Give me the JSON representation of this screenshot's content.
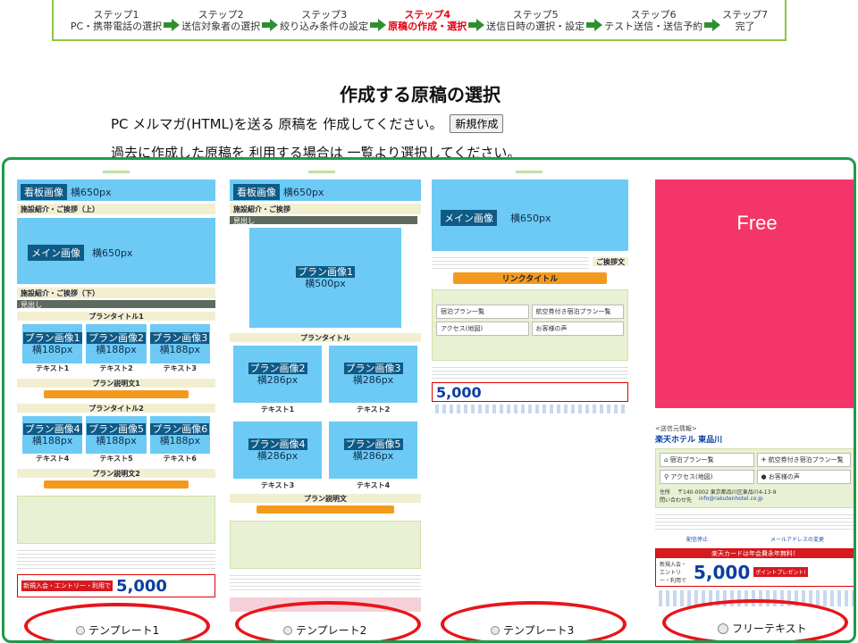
{
  "steps": [
    {
      "num": "ステップ1",
      "label": "PC・携帯電話の選択",
      "active": false
    },
    {
      "num": "ステップ2",
      "label": "送信対象者の選択",
      "active": false
    },
    {
      "num": "ステップ3",
      "label": "絞り込み条件の設定",
      "active": false
    },
    {
      "num": "ステップ4",
      "label": "原稿の作成・選択",
      "active": true
    },
    {
      "num": "ステップ5",
      "label": "送信日時の選択・設定",
      "active": false
    },
    {
      "num": "ステップ6",
      "label": "テスト送信・送信予約",
      "active": false
    },
    {
      "num": "ステップ7",
      "label": "完了",
      "active": false
    }
  ],
  "page": {
    "heading": "作成する原稿の選択",
    "line1_text": "PC メルマガ(HTML)を送る 原稿を 作成してください。",
    "new_button": "新規作成",
    "line2_text": "過去に作成した原稿を 利用する場合は 一覧より選択してください。"
  },
  "templates": {
    "t1": {
      "kanban": "看板画像",
      "kanban_size": "横650px",
      "intro_top": "施設紹介・ご挨拶（上）",
      "main": "メイン画像",
      "main_size": "横650px",
      "intro_bottom": "施設紹介・ご挨拶（下）",
      "midashi": "見出し",
      "plan_title_1": "プランタイトル1",
      "plan_images": [
        {
          "name": "プラン画像1",
          "size": "横188px",
          "text": "テキスト1"
        },
        {
          "name": "プラン画像2",
          "size": "横188px",
          "text": "テキスト2"
        },
        {
          "name": "プラン画像3",
          "size": "横188px",
          "text": "テキスト3"
        }
      ],
      "plan_desc_1": "プラン説明文1",
      "plan_title_2": "プランタイトル2",
      "plan_images_2": [
        {
          "name": "プラン画像4",
          "size": "横188px",
          "text": "テキスト4"
        },
        {
          "name": "プラン画像5",
          "size": "横188px",
          "text": "テキスト5"
        },
        {
          "name": "プラン画像6",
          "size": "横188px",
          "text": "テキスト6"
        }
      ],
      "plan_desc_2": "プラン説明文2",
      "radio_label": "テンプレート1"
    },
    "t2": {
      "kanban": "看板画像",
      "kanban_size": "横650px",
      "intro": "施設紹介・ご挨拶",
      "midashi": "見出し",
      "plan_image": "プラン画像1",
      "plan_image_size": "横500px",
      "plan_title": "プランタイトル",
      "plan_images": [
        {
          "name": "プラン画像2",
          "size": "横286px",
          "text": "テキスト1"
        },
        {
          "name": "プラン画像3",
          "size": "横286px",
          "text": "テキスト2"
        },
        {
          "name": "プラン画像4",
          "size": "横286px",
          "text": "テキスト3"
        },
        {
          "name": "プラン画像5",
          "size": "横286px",
          "text": "テキスト4"
        }
      ],
      "plan_desc": "プラン説明文",
      "radio_label": "テンプレート2"
    },
    "t3": {
      "main": "メイン画像",
      "main_size": "横650px",
      "greeting": "ご挨拶文",
      "link_title": "リンクタイトル",
      "radio_label": "テンプレート3"
    },
    "free": {
      "box_label": "Free",
      "hotel": "楽天ホテル 東品川",
      "info_label": "<送信元情報>",
      "btn_plans": "宿泊プラン一覧",
      "btn_air": "航空券付き宿泊プラン一覧",
      "btn_access": "アクセス(地図)",
      "btn_voice": "お客様の声",
      "address_label": "住所",
      "address": "〒140-0002 東京都品川区東品川4-13-9",
      "contact_label": "問い合わせ先",
      "contact": "info@rakutenhotel.co.jp",
      "link_stop": "配信停止",
      "link_change": "メールアドレスの変更",
      "banner_red": "楽天カードは年会費永年無料！",
      "banner_points": "5,000",
      "banner_tag": "ポイントプレゼント!",
      "banner_left": "新規入会・エントリー・利用で",
      "radio_label": "フリーテキスト"
    }
  },
  "colors": {
    "step_border": "#8cc63f",
    "step_arrow": "#2f8f2f",
    "active_step": "#e60012",
    "panel_border": "#1f9a4a",
    "image_blue": "#6ccaf5",
    "free_pink": "#f4356a",
    "highlight_ring": "#e8141a"
  }
}
